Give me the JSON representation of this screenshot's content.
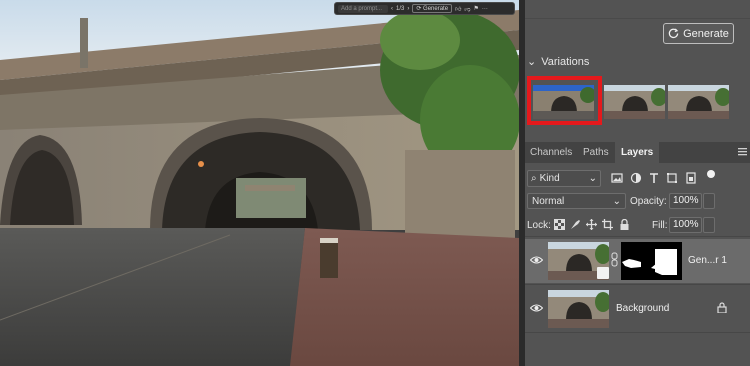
{
  "context_bar": {
    "prompt_placeholder": "Add a prompt...",
    "page_indicator": "1/3",
    "generate_label": "Generate",
    "icons": [
      "chevron-left-icon",
      "chevron-right-icon",
      "sparkle-icon",
      "thumbs-up-icon",
      "thumbs-down-icon",
      "flag-icon",
      "more-icon"
    ]
  },
  "generate_panel": {
    "generate_label": "Generate",
    "variations_label": "Variations",
    "variations": [
      {
        "name": "variation-1",
        "selected": true
      },
      {
        "name": "variation-2",
        "selected": false
      },
      {
        "name": "variation-3",
        "selected": false
      }
    ],
    "highlight_color": "#e5191c"
  },
  "panel_tabs": {
    "items": [
      {
        "label": "Channels"
      },
      {
        "label": "Paths"
      },
      {
        "label": "Layers",
        "active": true
      }
    ]
  },
  "layers_panel": {
    "filter_kind": "Kind",
    "blend_mode": "Normal",
    "opacity_label": "Opacity:",
    "opacity_value": "100%",
    "lock_label": "Lock:",
    "fill_label": "Fill:",
    "fill_value": "100%",
    "layers": [
      {
        "name": "Gen...r 1",
        "selected": true,
        "visible": true,
        "has_mask": true
      },
      {
        "name": "Background",
        "selected": false,
        "visible": true,
        "locked": true
      }
    ]
  },
  "colors": {
    "panel_bg": "#535353",
    "selected_row": "#6b6b6b",
    "accent_red": "#e5191c"
  }
}
